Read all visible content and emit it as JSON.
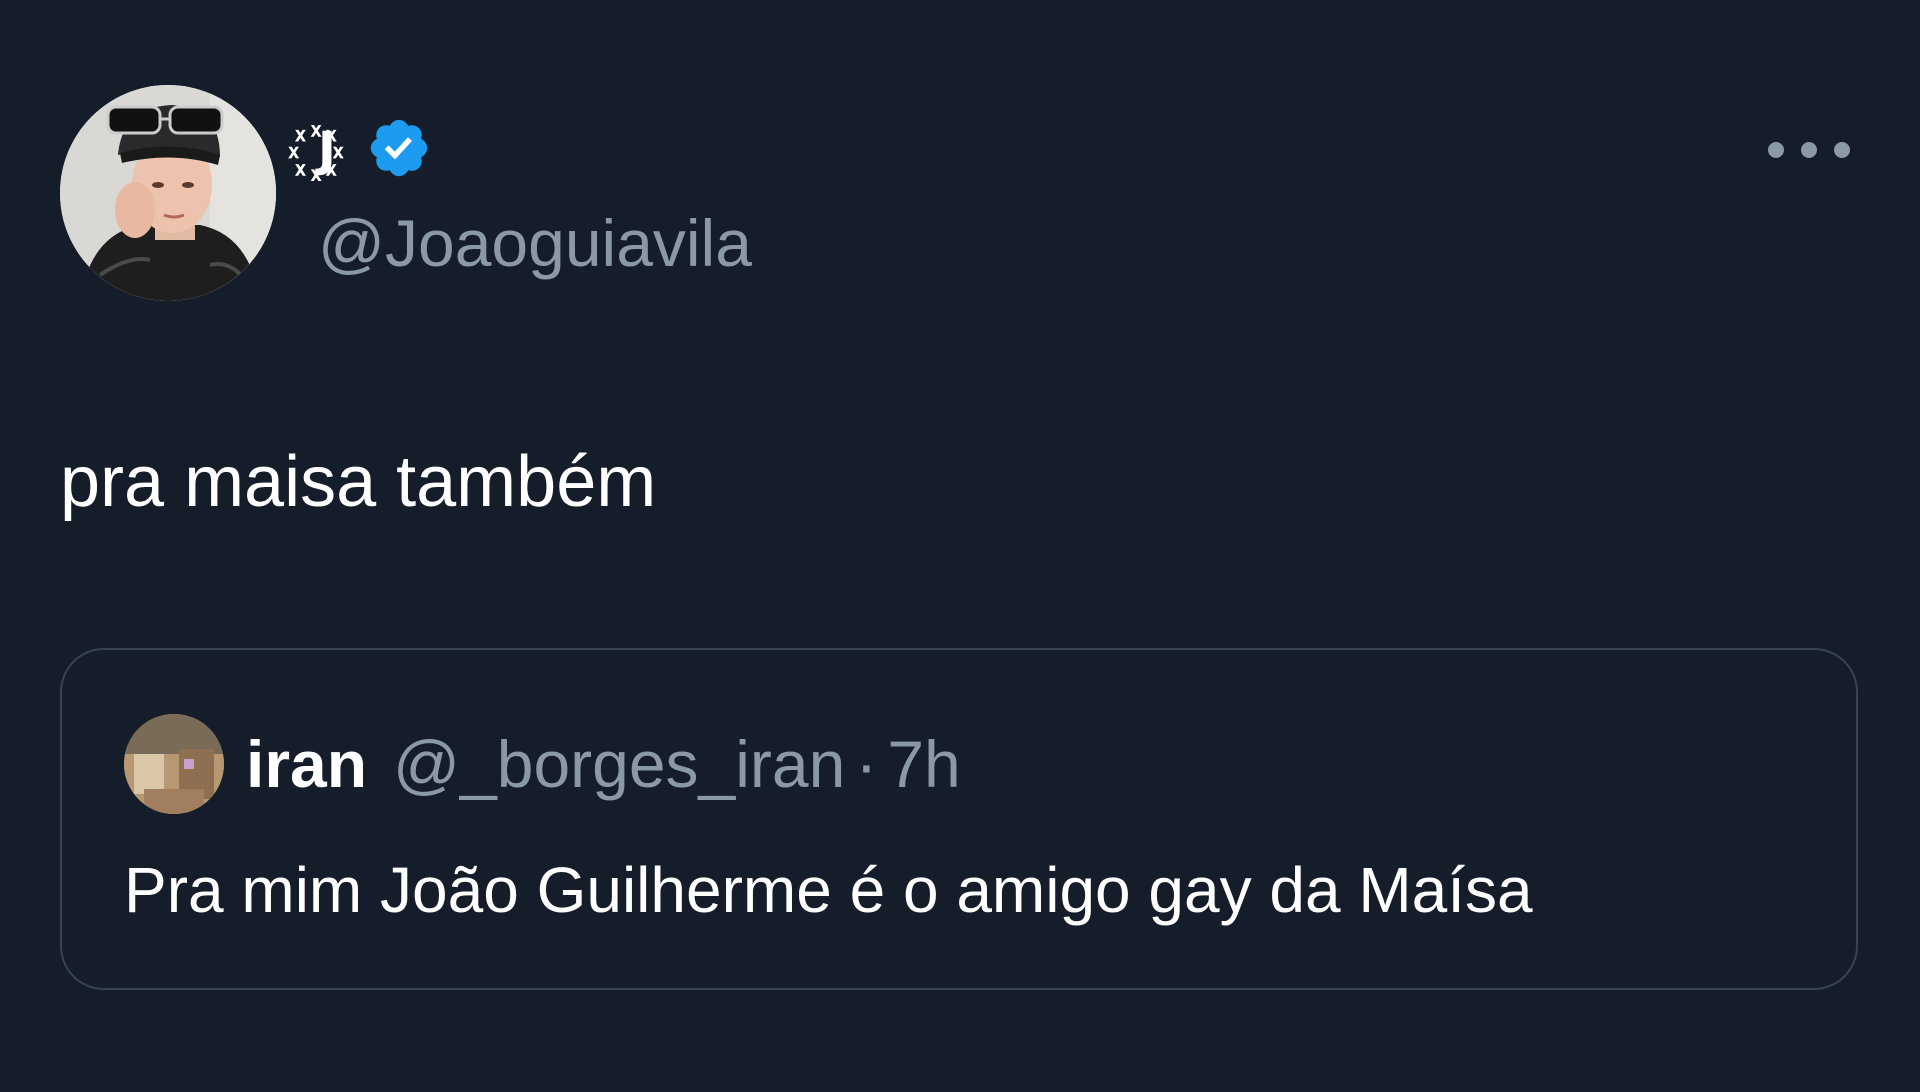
{
  "tweet": {
    "author": {
      "display_name": "꙰J",
      "handle": "@Joaoguiavila",
      "verified": true,
      "avatar_icon": "user-avatar-photo"
    },
    "more_icon": "more-horizontal-icon",
    "text": "pra maisa também",
    "quoted_tweet": {
      "author_name": "iran",
      "author_handle": "@_borges_iran",
      "separator": "·",
      "time": "7h",
      "avatar_icon": "user-avatar-photo",
      "text": "Pra mim João Guilherme é o amigo gay da Maísa"
    }
  },
  "colors": {
    "background": "#151d2a",
    "text_primary": "#ffffff",
    "text_secondary": "#8b98a5",
    "verified_blue": "#1d9bf0",
    "card_border": "#38444d"
  }
}
